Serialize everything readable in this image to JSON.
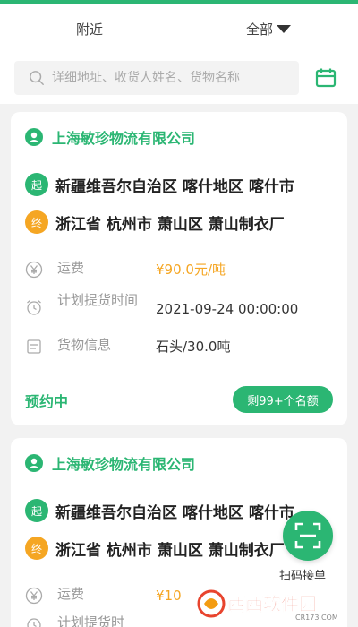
{
  "tabs": [
    {
      "label": "附近"
    },
    {
      "label": "全部"
    }
  ],
  "search": {
    "placeholder": "详细地址、收货人姓名、货物名称"
  },
  "orders": [
    {
      "company": "上海敏珍物流有限公司",
      "start_badge": "起",
      "start": "新疆维吾尔自治区 喀什地区 喀什市",
      "end_badge": "终",
      "end": "浙江省 杭州市 萧山区 萧山制衣厂",
      "freight_label": "运费",
      "freight": "¥90.0元/吨",
      "pickup_label": "计划提货时间",
      "pickup": "2021-09-24 00:00:00",
      "goods_label": "货物信息",
      "goods": "石头/30.0吨",
      "status": "预约中",
      "remain": "剩99+个名额"
    },
    {
      "company": "上海敏珍物流有限公司",
      "start_badge": "起",
      "start": "新疆维吾尔自治区 喀什地区 喀什市",
      "end_badge": "终",
      "end": "浙江省 杭州市 萧山区 萧山制衣厂",
      "freight_label": "运费",
      "freight": "¥10",
      "pickup_label": "计划提货时"
    }
  ],
  "scan": {
    "label": "扫码接单"
  },
  "watermark": {
    "text": "西西软件园",
    "sub": "CR173.COM"
  },
  "colors": {
    "accent": "#2bb673",
    "orange": "#f5a623"
  },
  "icons": [
    "search-icon",
    "calendar-icon",
    "person-icon",
    "yen-icon",
    "alarm-clock-icon",
    "document-icon",
    "scan-icon"
  ]
}
